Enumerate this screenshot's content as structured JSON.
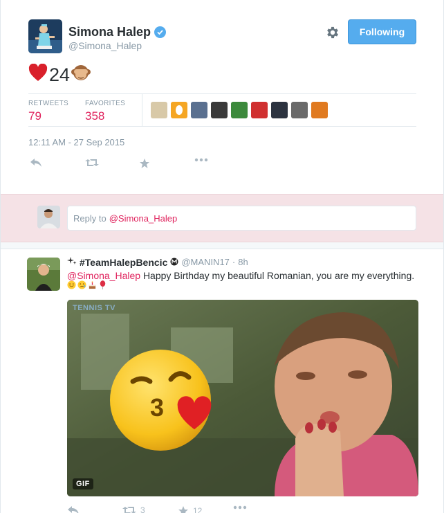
{
  "tweet": {
    "author_name": "Simona Halep",
    "author_handle": "@Simona_Halep",
    "follow_label": "Following",
    "text": "24",
    "stats": {
      "retweets_label": "RETWEETS",
      "retweets_value": "79",
      "favorites_label": "FAVORITES",
      "favorites_value": "358"
    },
    "timestamp": "12:11 AM - 27 Sep 2015"
  },
  "reply_box": {
    "prefix": "Reply to",
    "mention": "@Simona_Halep"
  },
  "reply_tweet": {
    "author_name": "#TeamHalepBencic",
    "author_handle": "@MANIN17",
    "separator": "·",
    "time": "8h",
    "mention": "@Simona_Halep",
    "text": "Happy Birthday my beautiful Romanian, you are my everything.",
    "media": {
      "badge": "GIF",
      "watermark": "TENNIS TV"
    },
    "retweet_count": "3",
    "favorite_count": "12"
  },
  "colors": {
    "accent": "#55acee",
    "highlight": "#e0245e",
    "muted": "#8899a6",
    "reply_band": "#f5e2e6"
  },
  "icons": [
    "verified-badge-icon",
    "gear-icon",
    "reply-icon",
    "retweet-icon",
    "favorite-icon",
    "more-icon"
  ]
}
